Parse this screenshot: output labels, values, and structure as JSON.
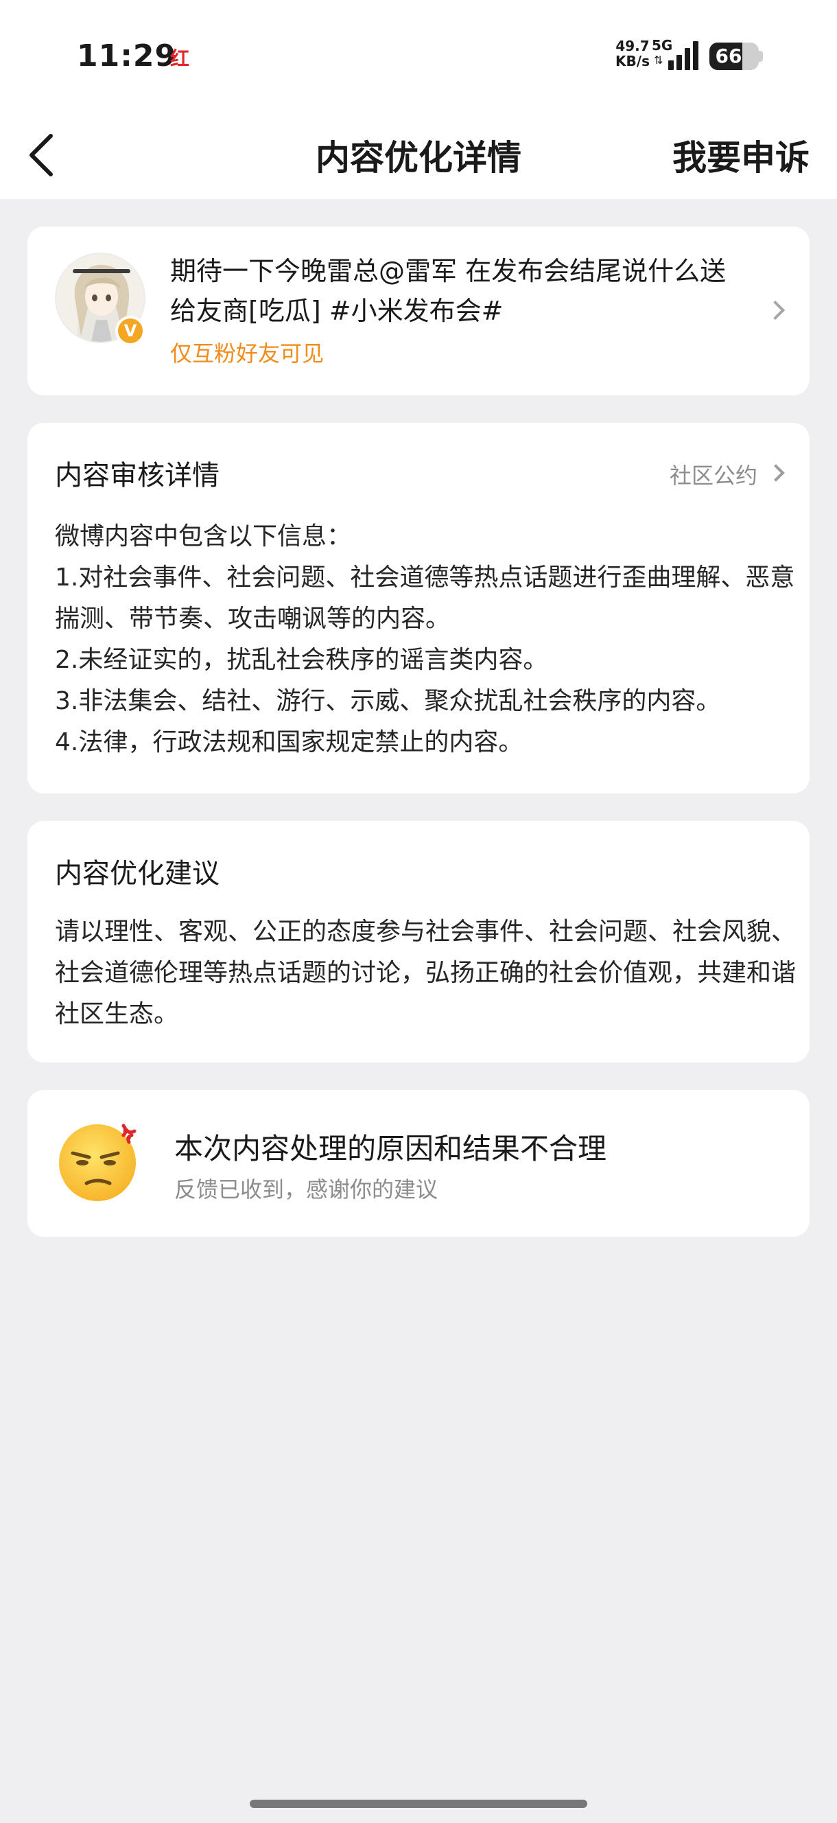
{
  "status_bar": {
    "time": "11:29",
    "notification_icon": "红",
    "net_speed_value": "49.7",
    "net_speed_unit": "KB/s",
    "network_type": "5G",
    "net_activity_icon": "data-arrows-icon",
    "battery_level": "66"
  },
  "nav": {
    "title": "内容优化详情",
    "back_icon": "chevron-left-icon",
    "appeal_label": "我要申诉"
  },
  "post": {
    "text": "期待一下今晚雷总@雷军 在发布会结尾说什么送给友商[吃瓜] #小米发布会#",
    "visibility": "仅互粉好友可见",
    "verify_badge": "V",
    "accent_color": "#f08c1a"
  },
  "review": {
    "title": "内容审核详情",
    "rules_link": "社区公约",
    "lines": [
      "微博内容中包含以下信息：",
      "1.对社会事件、社会问题、社会道德等热点话题进行歪曲理解、恶意揣测、带节奏、攻击嘲讽等的内容。",
      "2.未经证实的，扰乱社会秩序的谣言类内容。",
      "3.非法集会、结社、游行、示威、聚众扰乱社会秩序的内容。",
      "4.法律，行政法规和国家规定禁止的内容。"
    ]
  },
  "suggestion": {
    "title": "内容优化建议",
    "text": "请以理性、客观、公正的态度参与社会事件、社会问题、社会风貌、社会道德伦理等热点话题的讨论，弘扬正确的社会价值观，共建和谐社区生态。"
  },
  "feedback": {
    "emoji": "annoyed-face-icon",
    "title": "本次内容处理的原因和结果不合理",
    "subtitle": "反馈已收到，感谢你的建议"
  }
}
